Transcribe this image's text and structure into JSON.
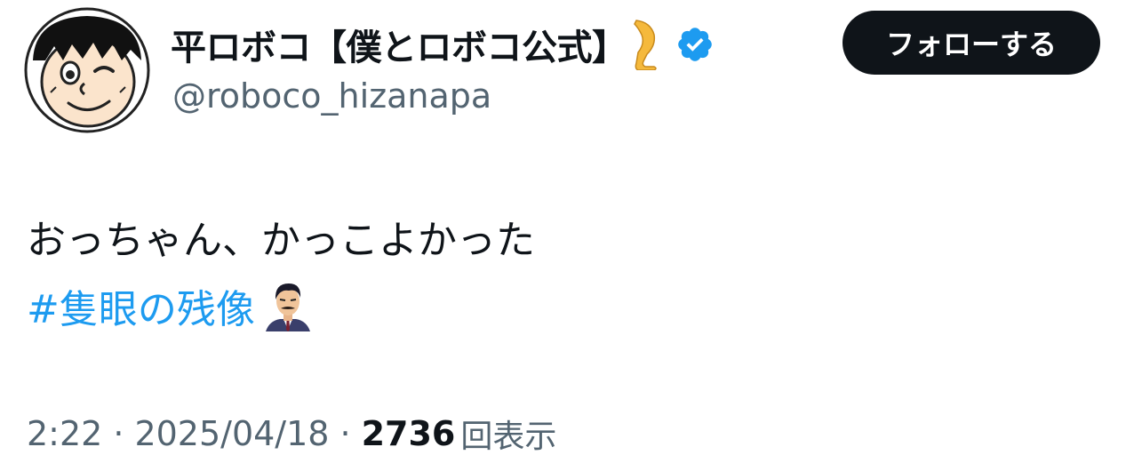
{
  "user": {
    "display_name": "平ロボコ【僕とロボコ公式】",
    "name_emoji_icon": "leg-icon",
    "verified_icon": "verified-badge-icon",
    "handle": "@roboco_hizanapa",
    "avatar_icon": "roboco-avatar"
  },
  "follow_button": {
    "label": "フォローする"
  },
  "tweet": {
    "text": "おっちゃん、かっこよかった",
    "hashtag": "#隻眼の残像",
    "hashflag_icon": "detective-mouri-hashflag-icon"
  },
  "meta": {
    "time": "2:22",
    "separator": "·",
    "date": "2025/04/18",
    "views_count": "2736",
    "views_label": "回表示"
  },
  "colors": {
    "text_primary": "#0f1419",
    "text_secondary": "#536471",
    "link_blue": "#1d9bf0",
    "button_bg": "#0f1419",
    "button_text": "#ffffff"
  }
}
